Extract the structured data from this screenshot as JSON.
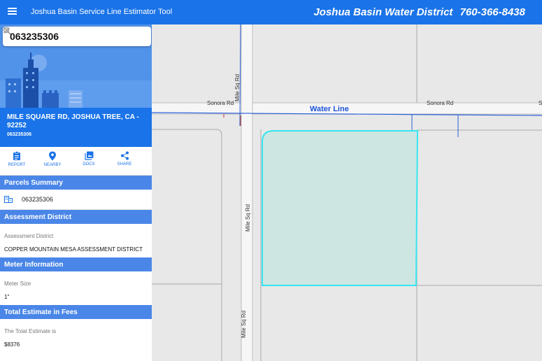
{
  "header": {
    "app_title": "Joshua Basin Service Line Estimator Tool",
    "district_name": "Joshua Basin Water District",
    "district_phone": "760-366-8438"
  },
  "search": {
    "value": "063235306"
  },
  "location": {
    "address": "MILE SQUARE RD, JOSHUA TREE, CA - 92252",
    "parcel_id": "063235306"
  },
  "actions": [
    {
      "label": "REPORT",
      "icon": "report-icon"
    },
    {
      "label": "NEARBY",
      "icon": "location-pin-icon"
    },
    {
      "label": "DOCS",
      "icon": "docs-icon"
    },
    {
      "label": "SHARE",
      "icon": "share-icon"
    }
  ],
  "sections": {
    "parcels": {
      "title": "Parcels Summary",
      "parcel": "063235306"
    },
    "assessment": {
      "title": "Assessment District",
      "label": "Assessment District",
      "value": "COPPER MOUNTAIN MESA ASSESSMENT DISTRICT"
    },
    "meter": {
      "title": "Meter Information",
      "label": "Meter Size",
      "value": "1\""
    },
    "estimate": {
      "title": "Total Estimate in Fees",
      "label": "The Total Estimate is",
      "value": "$8376"
    }
  },
  "map": {
    "roads": {
      "sonora_left": "Sonora Rd",
      "sonora_mid": "Sonora Rd",
      "sonora_right": "S",
      "mile_sq_top": "Mile Sq Rd",
      "mile_sq_mid": "Mile Sq Rd",
      "mile_sq_bottom": "Mile Sq Rd"
    },
    "water_line_label": "Water Line",
    "colors": {
      "parcel_outline": "#35e6f0",
      "parcel_fill": "#cde6e2",
      "water_line": "#2b5fd9",
      "header_blue": "#1a73e8"
    }
  }
}
